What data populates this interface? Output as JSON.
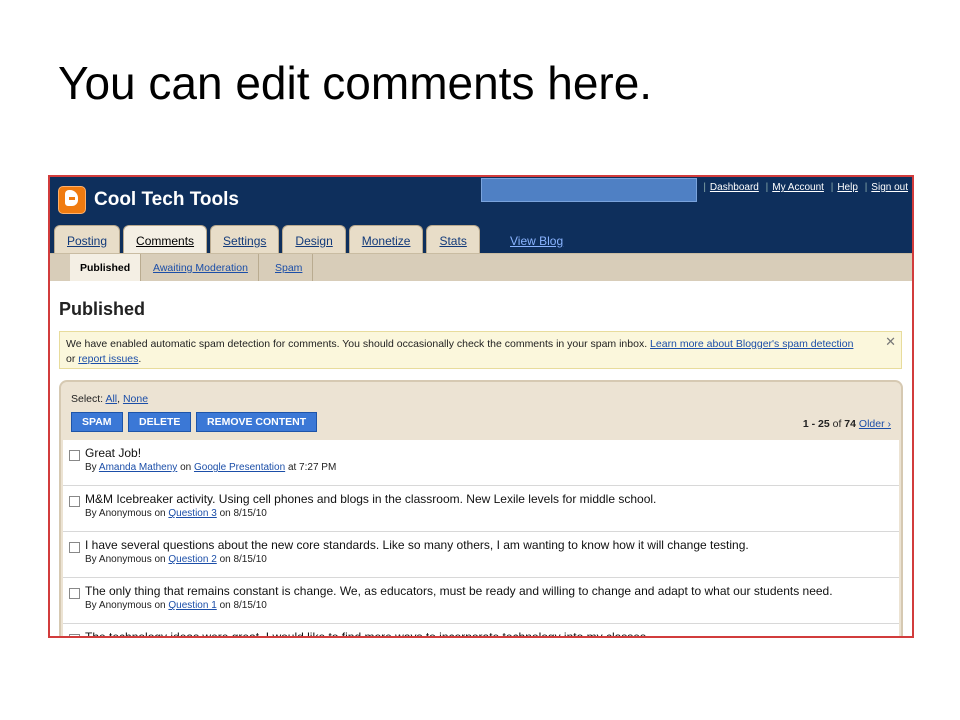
{
  "slide": {
    "title": "You can edit comments here."
  },
  "header": {
    "blog_title": "Cool Tech Tools",
    "links": [
      "Dashboard",
      "My Account",
      "Help",
      "Sign out"
    ],
    "search_value": ""
  },
  "tabs": [
    {
      "label": "Posting"
    },
    {
      "label": "Comments"
    },
    {
      "label": "Settings"
    },
    {
      "label": "Design"
    },
    {
      "label": "Monetize"
    },
    {
      "label": "Stats"
    }
  ],
  "view_blog": "View Blog",
  "subtabs": [
    {
      "label": "Published"
    },
    {
      "label": "Awaiting Moderation"
    },
    {
      "label": "Spam"
    }
  ],
  "page_title": "Published",
  "notice": {
    "text": "We have enabled automatic spam detection for comments. You should occasionally check the comments in your spam inbox.",
    "link1": "Learn more about Blogger's spam detection",
    "or": "or",
    "link2": "report issues",
    "period": ".",
    "close": "✕"
  },
  "select": {
    "label": "Select:",
    "all": "All",
    "sep": ",",
    "none": "None"
  },
  "buttons": {
    "spam": "SPAM",
    "delete": "DELETE",
    "remove": "REMOVE CONTENT"
  },
  "pager": {
    "range": "1 - 25",
    "of": "of",
    "total": "74",
    "older": "Older ›"
  },
  "comments": [
    {
      "text": "Great Job!",
      "by": "By",
      "author": "Amanda Matheny",
      "on": "on",
      "post": "Google Presentation",
      "at": "at 7:27 PM"
    },
    {
      "text": "M&M Icebreaker activity. Using cell phones and blogs in the classroom. New Lexile levels for middle school.",
      "by": "By",
      "author": "Anonymous",
      "on": "on",
      "post": "Question 3",
      "at": "on 8/15/10"
    },
    {
      "text": "I have several questions about the new core standards. Like so many others, I am wanting to know how it will change testing.",
      "by": "By",
      "author": "Anonymous",
      "on": "on",
      "post": "Question 2",
      "at": "on 8/15/10"
    },
    {
      "text": "The only thing that remains constant is change. We, as educators, must be ready and willing to change and adapt to what our students need.",
      "by": "By",
      "author": "Anonymous",
      "on": "on",
      "post": "Question 1",
      "at": "on 8/15/10"
    },
    {
      "text": "The technology ideas were great. I would like to find more ways to incorporate technology into my classes.",
      "by": "",
      "author": "",
      "on": "",
      "post": "",
      "at": ""
    }
  ]
}
